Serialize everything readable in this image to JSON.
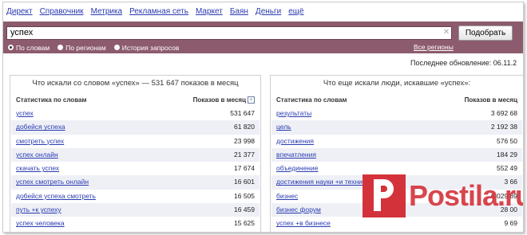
{
  "nav": [
    "Директ",
    "Справочник",
    "Метрика",
    "Рекламная сеть",
    "Маркет",
    "Баян",
    "Деньги",
    "ещё"
  ],
  "search": {
    "value": "успех",
    "clear_glyph": "✕",
    "button": "Подобрать",
    "modes": [
      "По словам",
      "По регионам",
      "История запросов"
    ],
    "selected_mode": "По словам",
    "regions_link": "Все регионы"
  },
  "last_update": "Последнее обновление: 06.11.2",
  "left_panel": {
    "title": "Что искали со словом «успех» — 531 647 показов в месяц",
    "col_query": "Статистика по словам",
    "col_count": "Показов в месяц",
    "plus_glyph": "+",
    "rows": [
      {
        "q": "успех",
        "n": "531 647"
      },
      {
        "q": "добейся успеха",
        "n": "61 820"
      },
      {
        "q": "смотреть успех",
        "n": "23 998"
      },
      {
        "q": "успех онлайн",
        "n": "21 377"
      },
      {
        "q": "скачать успех",
        "n": "17 674"
      },
      {
        "q": "успех смотреть онлайн",
        "n": "16 601"
      },
      {
        "q": "добейся успеха смотреть",
        "n": "16 505"
      },
      {
        "q": "путь +к успеху",
        "n": "16 459"
      },
      {
        "q": "успех человека",
        "n": "15 625"
      }
    ]
  },
  "right_panel": {
    "title": "Что еще искали люди, искавшие «успех»:",
    "col_query": "Статистика по словам",
    "col_count": "Показов в месяц",
    "rows": [
      {
        "q": "результаты",
        "n": "3 692 68"
      },
      {
        "q": "цель",
        "n": "2 192 38"
      },
      {
        "q": "достижения",
        "n": "576 50"
      },
      {
        "q": "впечатления",
        "n": "184 29"
      },
      {
        "q": "объединение",
        "n": "552 49"
      },
      {
        "q": "достижения науки +и техники",
        "n": "3 66"
      },
      {
        "q": "бизнес",
        "n": "6 029 89"
      },
      {
        "q": "бизнес форум",
        "n": "28 00"
      },
      {
        "q": "успех +в бизнесе",
        "n": "9 69"
      }
    ]
  },
  "watermark": {
    "text": "Postila.ru"
  },
  "colors": {
    "accent_bar": "#8d5b6e",
    "link": "#2a3bb0",
    "row_alt": "#eef0f6",
    "watermark": "#d4323a"
  }
}
